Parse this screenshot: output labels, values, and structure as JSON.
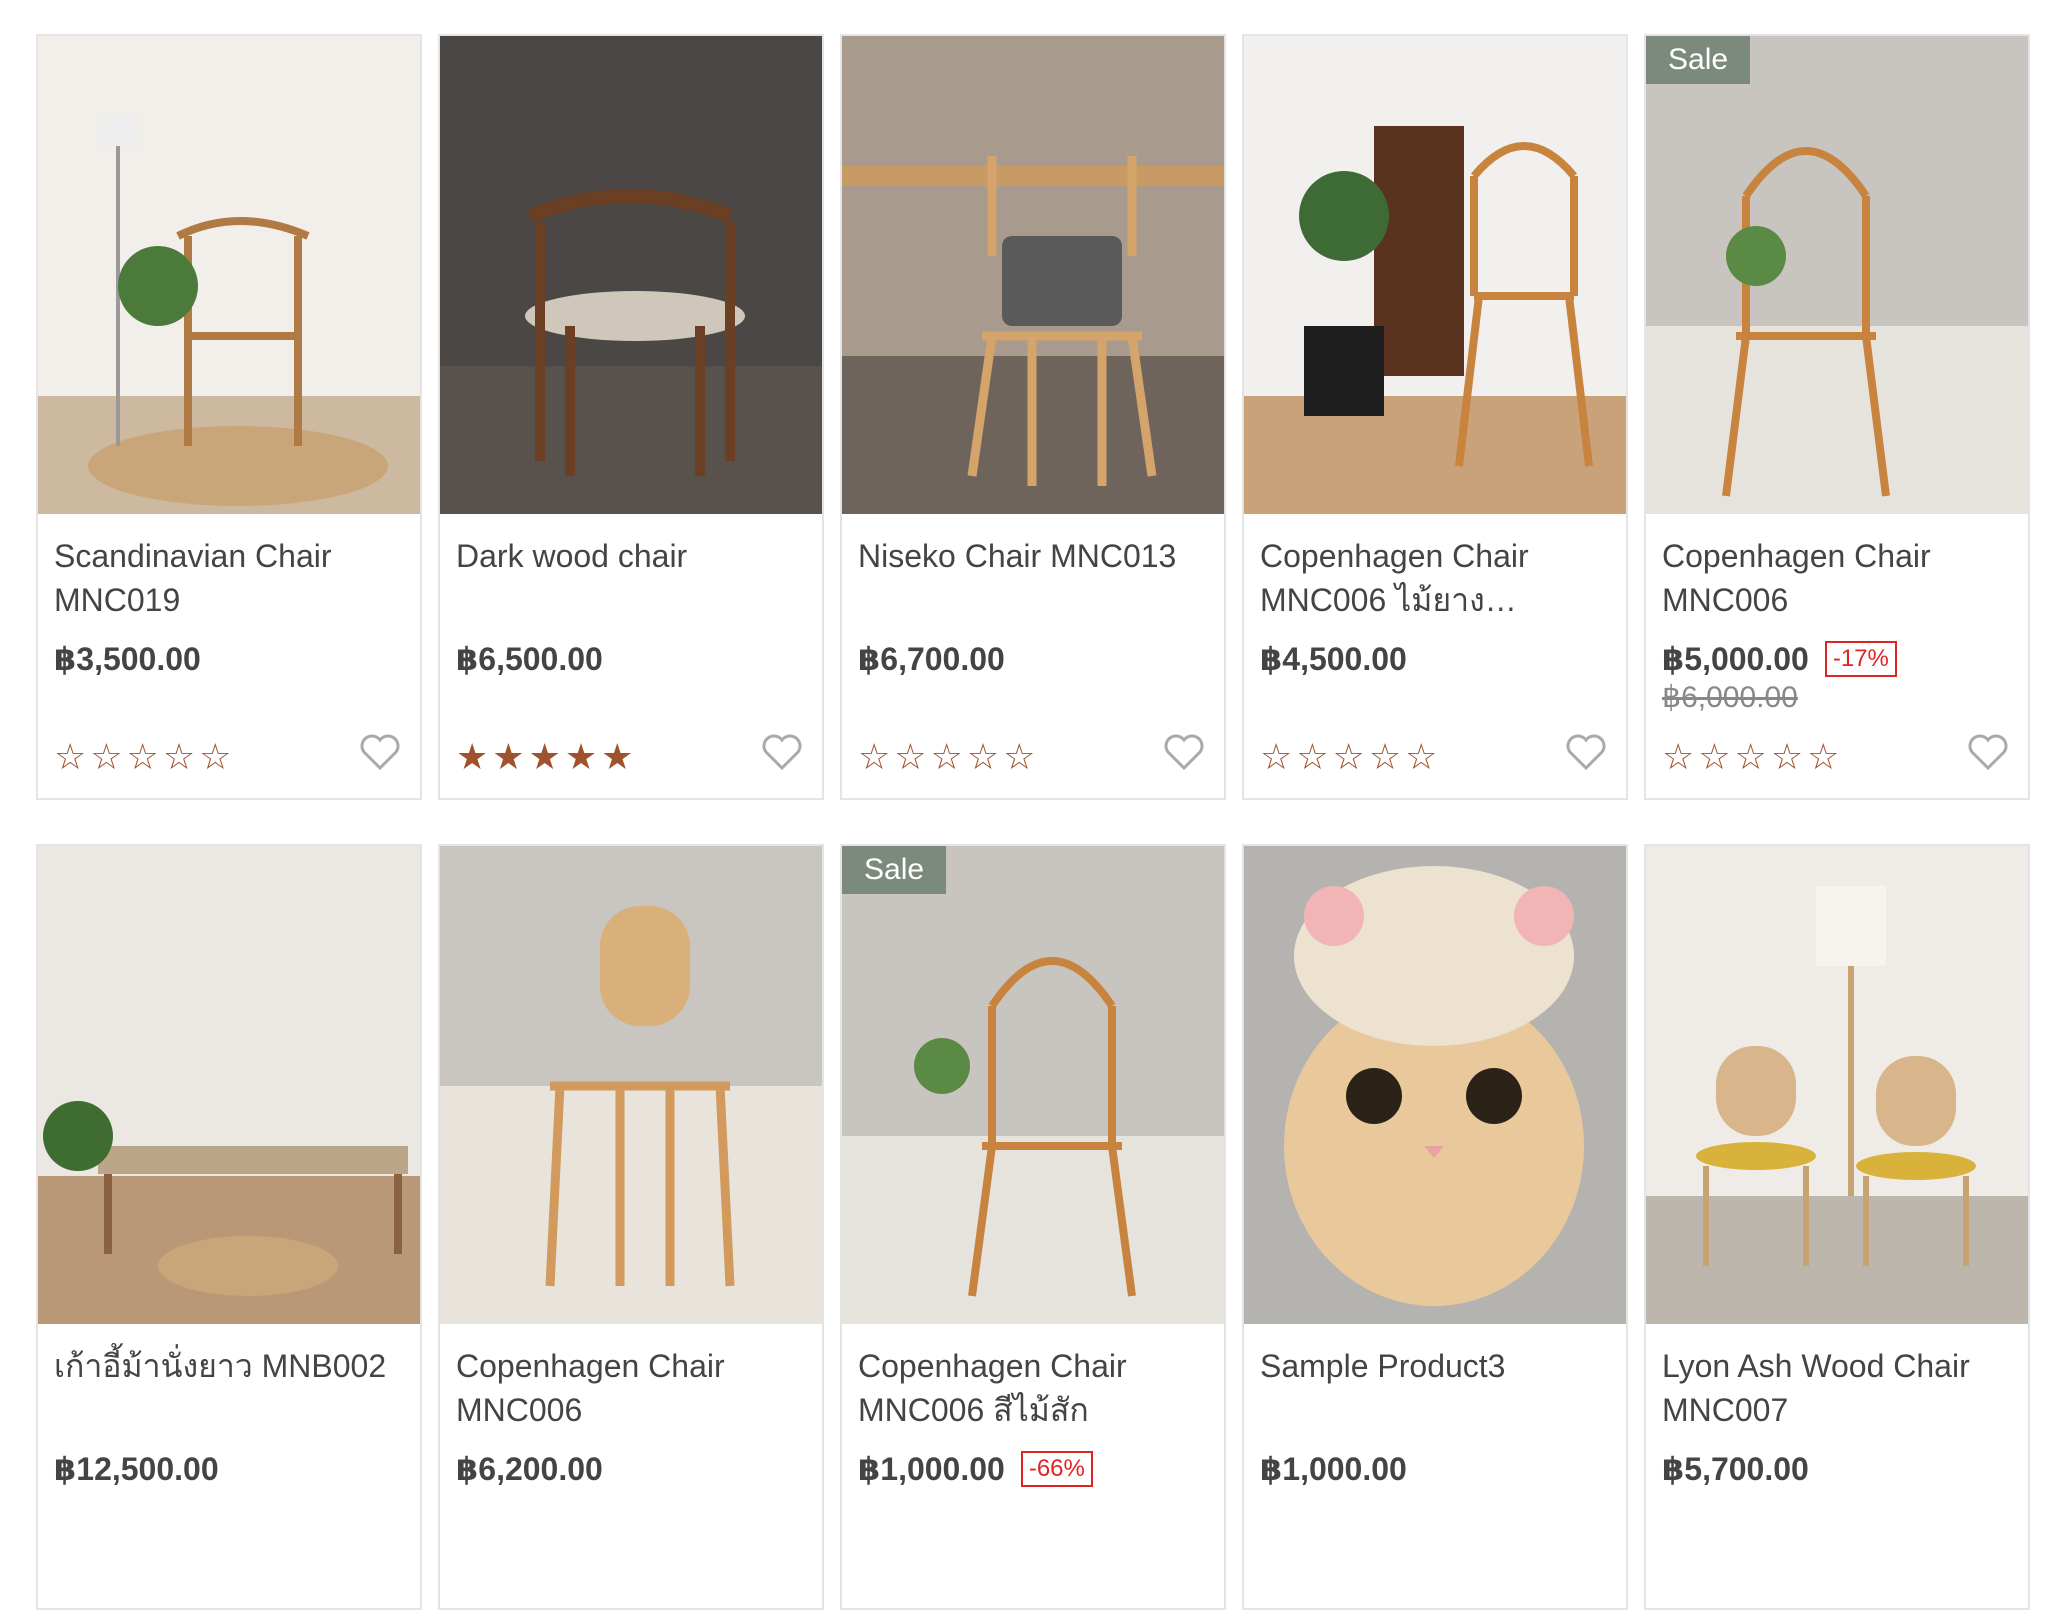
{
  "products": [
    {
      "name": "Scandinavian Chair MNC019",
      "price": "฿3,500.00",
      "stars": "☆☆☆☆☆",
      "sale": "",
      "discount": "",
      "old_price": ""
    },
    {
      "name": "Dark wood chair",
      "price": "฿6,500.00",
      "stars": "★★★★★",
      "sale": "",
      "discount": "",
      "old_price": ""
    },
    {
      "name": "Niseko Chair MNC013",
      "price": "฿6,700.00",
      "stars": "☆☆☆☆☆",
      "sale": "",
      "discount": "",
      "old_price": ""
    },
    {
      "name": "Copenhagen Chair MNC006 ไม้ยาง…",
      "price": "฿4,500.00",
      "stars": "☆☆☆☆☆",
      "sale": "",
      "discount": "",
      "old_price": ""
    },
    {
      "name": "Copenhagen Chair MNC006",
      "price": "฿5,000.00",
      "stars": "☆☆☆☆☆",
      "sale": "Sale",
      "discount": "-17%",
      "old_price": "฿6,000.00"
    },
    {
      "name": "เก้าอี้ม้านั่งยาว MNB002",
      "price": "฿12,500.00",
      "stars": "",
      "sale": "",
      "discount": "",
      "old_price": ""
    },
    {
      "name": "Copenhagen Chair MNC006",
      "price": "฿6,200.00",
      "stars": "",
      "sale": "",
      "discount": "",
      "old_price": ""
    },
    {
      "name": "Copenhagen Chair MNC006 สีไม้สัก",
      "price": "฿1,000.00",
      "stars": "",
      "sale": "Sale",
      "discount": "-66%",
      "old_price": ""
    },
    {
      "name": "Sample Product3",
      "price": "฿1,000.00",
      "stars": "",
      "sale": "",
      "discount": "",
      "old_price": ""
    },
    {
      "name": "Lyon Ash Wood Chair MNC007",
      "price": "฿5,700.00",
      "stars": "",
      "sale": "",
      "discount": "",
      "old_price": ""
    }
  ],
  "colors": {
    "star": "#a0522d",
    "sale_badge": "#7b8a7c",
    "discount": "#e02424"
  },
  "icons": {
    "wishlist": "heart-outline-icon",
    "rating": "star-icon"
  }
}
